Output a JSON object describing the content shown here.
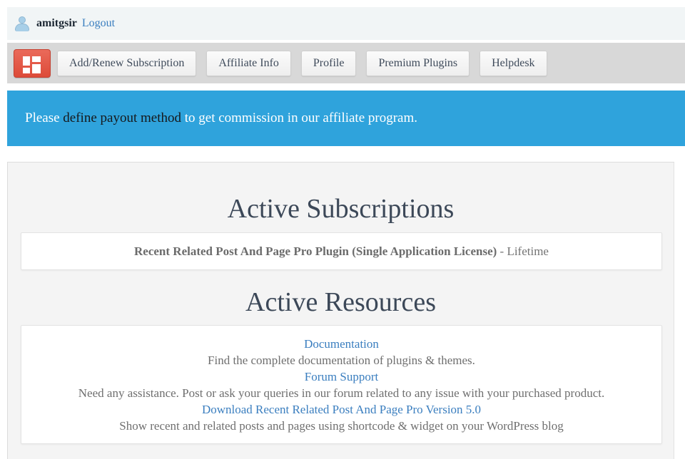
{
  "userbar": {
    "avatar_icon": "user-avatar-icon",
    "username": "amitgsir",
    "logout_label": "Logout"
  },
  "nav": {
    "logo_icon": "grid-logo-icon",
    "tabs": [
      {
        "label": "Add/Renew Subscription"
      },
      {
        "label": "Affiliate Info"
      },
      {
        "label": "Profile"
      },
      {
        "label": "Premium Plugins"
      },
      {
        "label": "Helpdesk"
      }
    ]
  },
  "alert": {
    "prefix": "Please ",
    "link_label": "define payout method",
    "suffix": " to get commission in our affiliate program.",
    "background_color": "#2fa3dc"
  },
  "main": {
    "subscriptions": {
      "heading": "Active Subscriptions",
      "items": [
        {
          "name": "Recent Related Post And Page Pro Plugin (Single Application License)",
          "term": " - Lifetime"
        }
      ]
    },
    "resources": {
      "heading": "Active Resources",
      "items": [
        {
          "link_label": "Documentation",
          "description": "Find the complete documentation of plugins & themes."
        },
        {
          "link_label": "Forum Support",
          "description": "Need any assistance. Post or ask your queries in our forum related to any issue with your purchased product."
        },
        {
          "link_label": "Download Recent Related Post And Page Pro Version 5.0",
          "description": "Show recent and related posts and pages using shortcode & widget on your WordPress blog"
        }
      ]
    }
  },
  "colors": {
    "link": "#3a7ebf",
    "accent_red": "#dd4b39",
    "alert_blue": "#2fa3dc"
  }
}
